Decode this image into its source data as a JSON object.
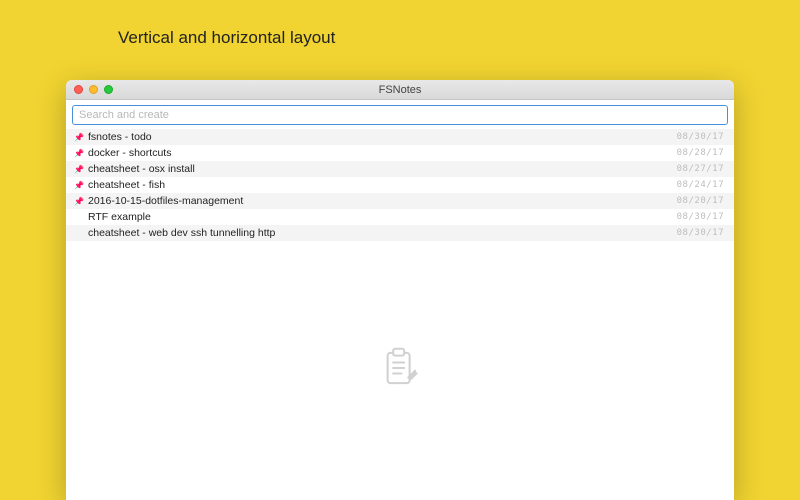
{
  "heading": "Vertical and horizontal layout",
  "window": {
    "title": "FSNotes"
  },
  "search": {
    "placeholder": "Search and create",
    "value": ""
  },
  "notes": [
    {
      "pinned": true,
      "title": "fsnotes - todo",
      "date": "08/30/17"
    },
    {
      "pinned": true,
      "title": "docker - shortcuts",
      "date": "08/28/17"
    },
    {
      "pinned": true,
      "title": "cheatsheet - osx install",
      "date": "08/27/17"
    },
    {
      "pinned": true,
      "title": "cheatsheet - fish",
      "date": "08/24/17"
    },
    {
      "pinned": true,
      "title": "2016-10-15-dotfiles-management",
      "date": "08/20/17"
    },
    {
      "pinned": false,
      "title": "RTF example",
      "date": "08/30/17"
    },
    {
      "pinned": false,
      "title": "cheatsheet - web dev ssh tunnelling http",
      "date": "08/30/17"
    }
  ],
  "icons": {
    "pin": "📌",
    "empty": "clipboard"
  }
}
